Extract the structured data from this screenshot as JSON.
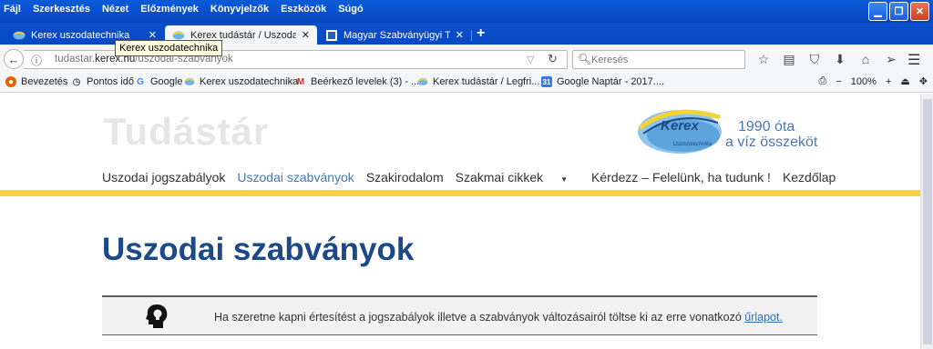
{
  "menu": [
    "Fájl",
    "Szerkesztés",
    "Nézet",
    "Előzmények",
    "Könyvjelzők",
    "Eszközök",
    "Súgó"
  ],
  "window_controls": [
    "minimize-icon",
    "restore-icon",
    "close-icon"
  ],
  "tabs": [
    {
      "title": "Kerex uszodatechnika",
      "active": false
    },
    {
      "title": "Kerex tudástár / Uszodai...",
      "active": true
    },
    {
      "title": "Magyar Szabványügyi T...",
      "active": false
    }
  ],
  "tooltip": "Kerex uszodatechnika",
  "navbar": {
    "url_host": "tudastar.kerex.hu",
    "url_domain_prefix": "tudastar.",
    "url_domain": "kerex.hu",
    "url_path": "/uszodai-szabvanyok",
    "search_placeholder": "Keresés"
  },
  "bookmarks": [
    {
      "label": "Bevezetés",
      "icon": "firefox-icon"
    },
    {
      "label": "Pontos idő",
      "icon": "clock-icon"
    },
    {
      "label": "Google",
      "icon": "google-icon"
    },
    {
      "label": "Kerex uszodatechnika",
      "icon": "kerex-icon"
    },
    {
      "label": "Beérkező levelek (3) - ...",
      "icon": "gmail-icon"
    },
    {
      "label": "Kerex tudástár / Legfri...",
      "icon": "kerex-icon"
    },
    {
      "label": "Google Naptár - 2017....",
      "icon": "calendar-icon"
    }
  ],
  "zoom": "100%",
  "site": {
    "name": "Tudástár",
    "logo_text": "Kerex",
    "logo_subtext": "Uszodatechnika",
    "tagline_line1": "1990 óta",
    "tagline_line2": "a víz összeköt"
  },
  "main_nav": [
    {
      "label": "Uszodai jogszabályok",
      "active": false
    },
    {
      "label": "Uszodai szabványok",
      "active": true
    },
    {
      "label": "Szakirodalom",
      "active": false
    },
    {
      "label": "Szakmai cikkek",
      "active": false,
      "dropdown": true
    },
    {
      "label": "Kérdezz – Felelünk, ha tudunk !",
      "active": false
    },
    {
      "label": "Kezdőlap",
      "active": false
    }
  ],
  "page_title": "Uszodai szabványok",
  "notice": {
    "text": "Ha szeretne kapni értesítést a jogszabályok illetve a szabványok változásairól töltse ki az erre vonatkozó ",
    "link": "űrlapot."
  },
  "colors": {
    "accent_blue": "#1b4a86",
    "active_nav": "#3e79b5",
    "yellow_band": "#f5d335",
    "xp_titlebar": "#0a4ecb"
  }
}
